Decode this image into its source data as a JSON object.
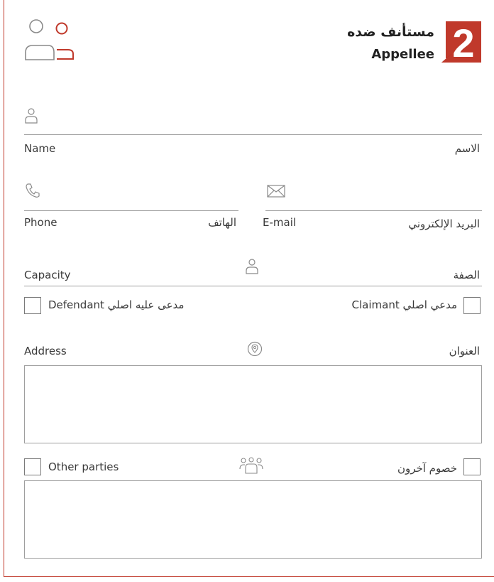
{
  "header": {
    "section_number": "2",
    "title_ar": "مستأنف ضده",
    "title_en": "Appellee"
  },
  "name": {
    "label_en": "Name",
    "label_ar": "الاسم"
  },
  "phone": {
    "label_en": "Phone",
    "label_ar": "الهاتف"
  },
  "email": {
    "label_en": "E-mail",
    "label_ar": "البريد الإلكتروني"
  },
  "capacity": {
    "label_en": "Capacity",
    "label_ar": "الصفة",
    "claimant_label": "مدعي اصلي Claimant",
    "defendant_label": "مدعى عليه اصلي Defendant"
  },
  "address": {
    "label_en": "Address",
    "label_ar": "العنوان"
  },
  "other_parties": {
    "label_en": "Other parties",
    "label_ar": "خصوم آخرون"
  },
  "colors": {
    "accent": "#c0392b",
    "line": "#9e9e9e"
  }
}
